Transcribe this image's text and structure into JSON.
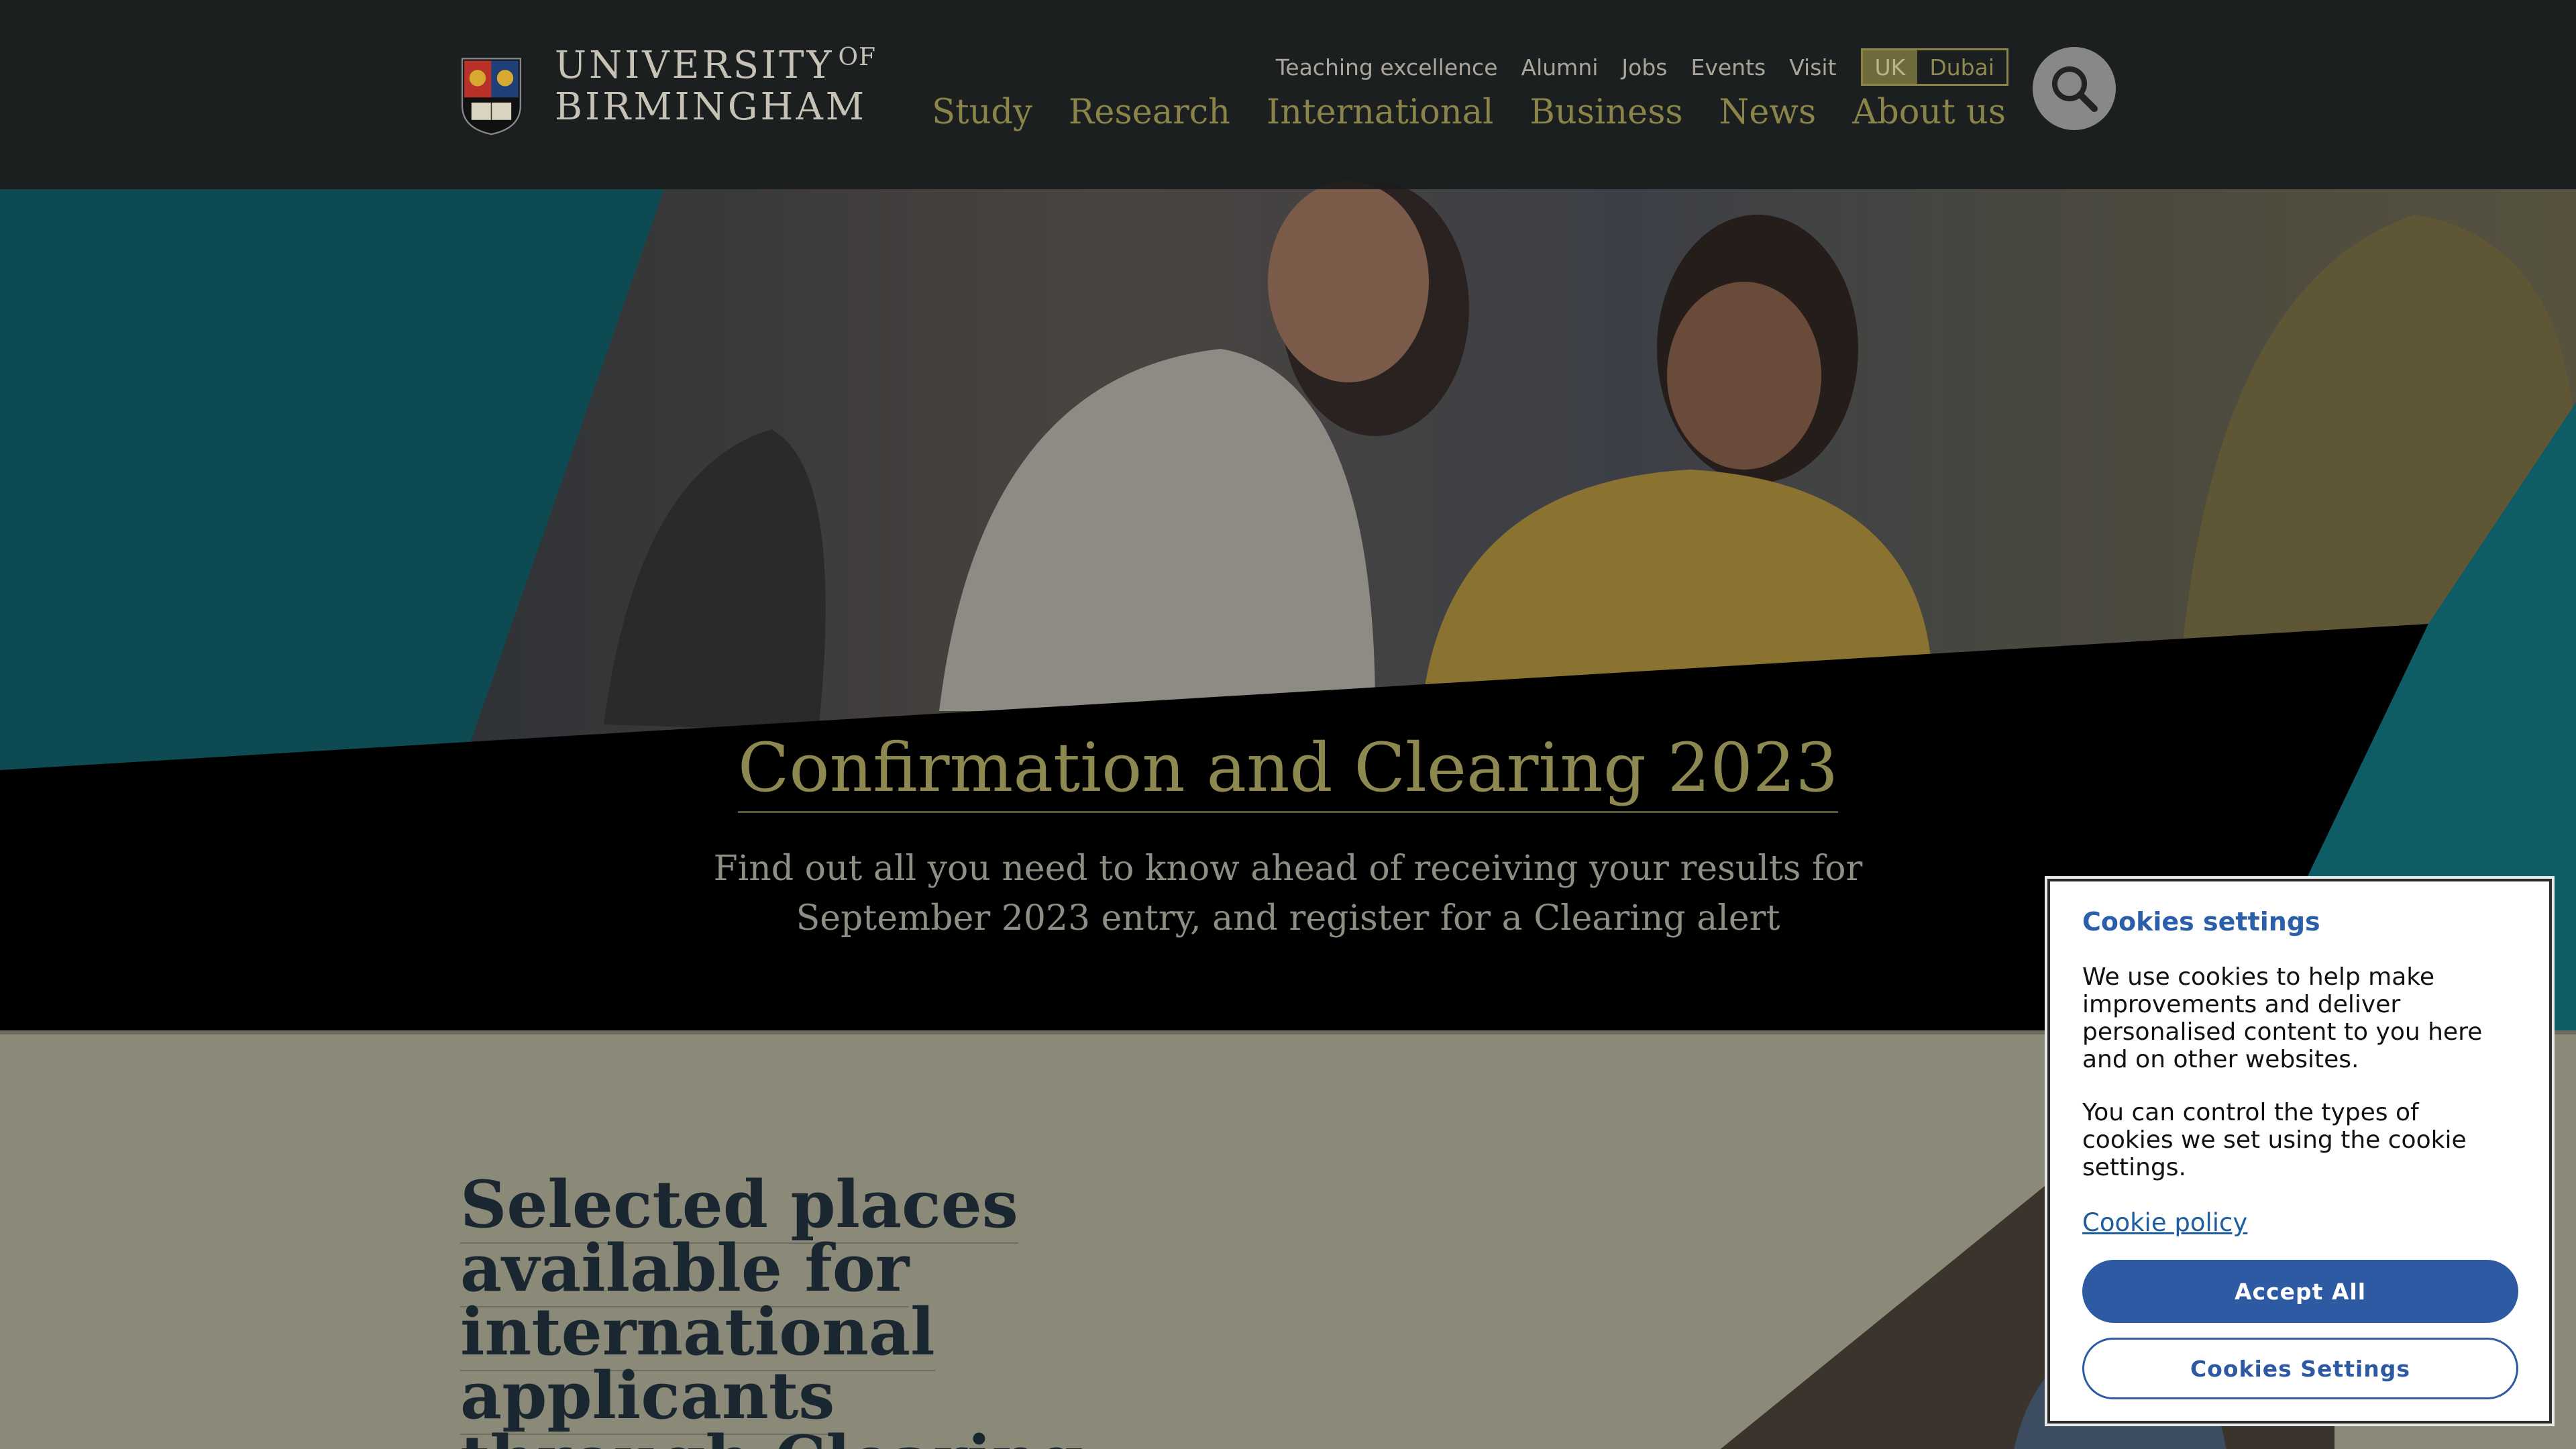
{
  "brand": {
    "line1": "UNIVERSITY",
    "of": "OF",
    "line2": "BIRMINGHAM"
  },
  "utility_nav": [
    "Teaching excellence",
    "Alumni",
    "Jobs",
    "Events",
    "Visit"
  ],
  "region": {
    "active": "UK",
    "other": "Dubai"
  },
  "main_nav": [
    "Study",
    "Research",
    "International",
    "Business",
    "News",
    "About us"
  ],
  "hero": {
    "title": "Confirmation and Clearing 2023",
    "subtitle": "Find out all you need to know ahead of receiving your results for September 2023 entry, and register for a Clearing alert"
  },
  "section": {
    "heading_lines": [
      "Selected places",
      "available for",
      "international applicants",
      "through Clearing"
    ]
  },
  "cookie": {
    "title": "Cookies settings",
    "p1": "We use cookies to help make improvements and deliver personalised content to you here and on other websites.",
    "p2": "You can control the types of cookies we set using the cookie settings.",
    "policy_link": "Cookie policy",
    "accept": "Accept All",
    "settings": "Cookies Settings"
  },
  "colors": {
    "accent_teal": "#0e7a89",
    "gold": "#8a8448",
    "cookie_blue": "#2d5aa3"
  }
}
